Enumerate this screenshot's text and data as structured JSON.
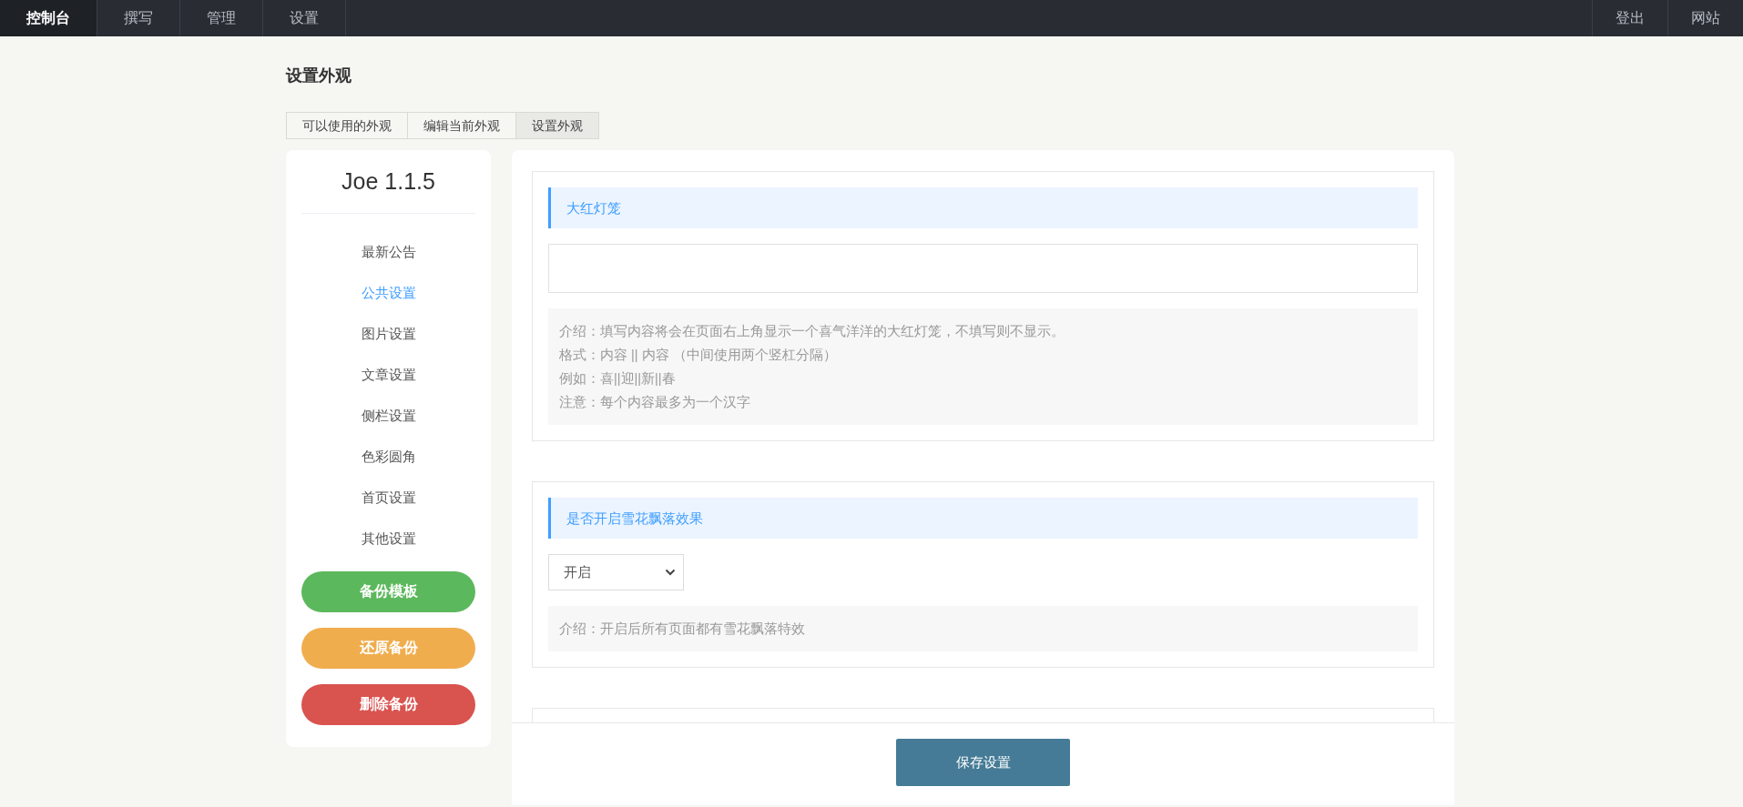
{
  "nav": {
    "left": [
      {
        "label": "控制台",
        "selected": true
      },
      {
        "label": "撰写",
        "selected": false
      },
      {
        "label": "管理",
        "selected": false
      },
      {
        "label": "设置",
        "selected": false
      }
    ],
    "right": [
      "登出",
      "网站"
    ]
  },
  "page_title": "设置外观",
  "tabs": [
    {
      "label": "可以使用的外观",
      "selected": false
    },
    {
      "label": "编辑当前外观",
      "selected": false
    },
    {
      "label": "设置外观",
      "selected": true
    }
  ],
  "sidebar": {
    "version": "Joe 1.1.5",
    "items": [
      {
        "label": "最新公告",
        "selected": false
      },
      {
        "label": "公共设置",
        "selected": true
      },
      {
        "label": "图片设置",
        "selected": false
      },
      {
        "label": "文章设置",
        "selected": false
      },
      {
        "label": "侧栏设置",
        "selected": false
      },
      {
        "label": "色彩圆角",
        "selected": false
      },
      {
        "label": "首页设置",
        "selected": false
      },
      {
        "label": "其他设置",
        "selected": false
      }
    ],
    "buttons": [
      {
        "label": "备份模板",
        "color": "#5cb85c"
      },
      {
        "label": "还原备份",
        "color": "#f0ad4e"
      },
      {
        "label": "删除备份",
        "color": "#d9534f"
      }
    ]
  },
  "sections": [
    {
      "kind": "text",
      "title": "大红灯笼",
      "description": [
        "介绍：填写内容将会在页面右上角显示一个喜气洋洋的大红灯笼，不填写则不显示。",
        "格式：内容 || 内容 （中间使用两个竖杠分隔）",
        "例如：喜||迎||新||春",
        "注意：每个内容最多为一个汉字"
      ]
    },
    {
      "kind": "select",
      "title": "是否开启雪花飘落效果",
      "value": "开启",
      "description": [
        "介绍：开启后所有页面都有雪花飘落特效"
      ]
    }
  ],
  "save_button": "保存设置"
}
